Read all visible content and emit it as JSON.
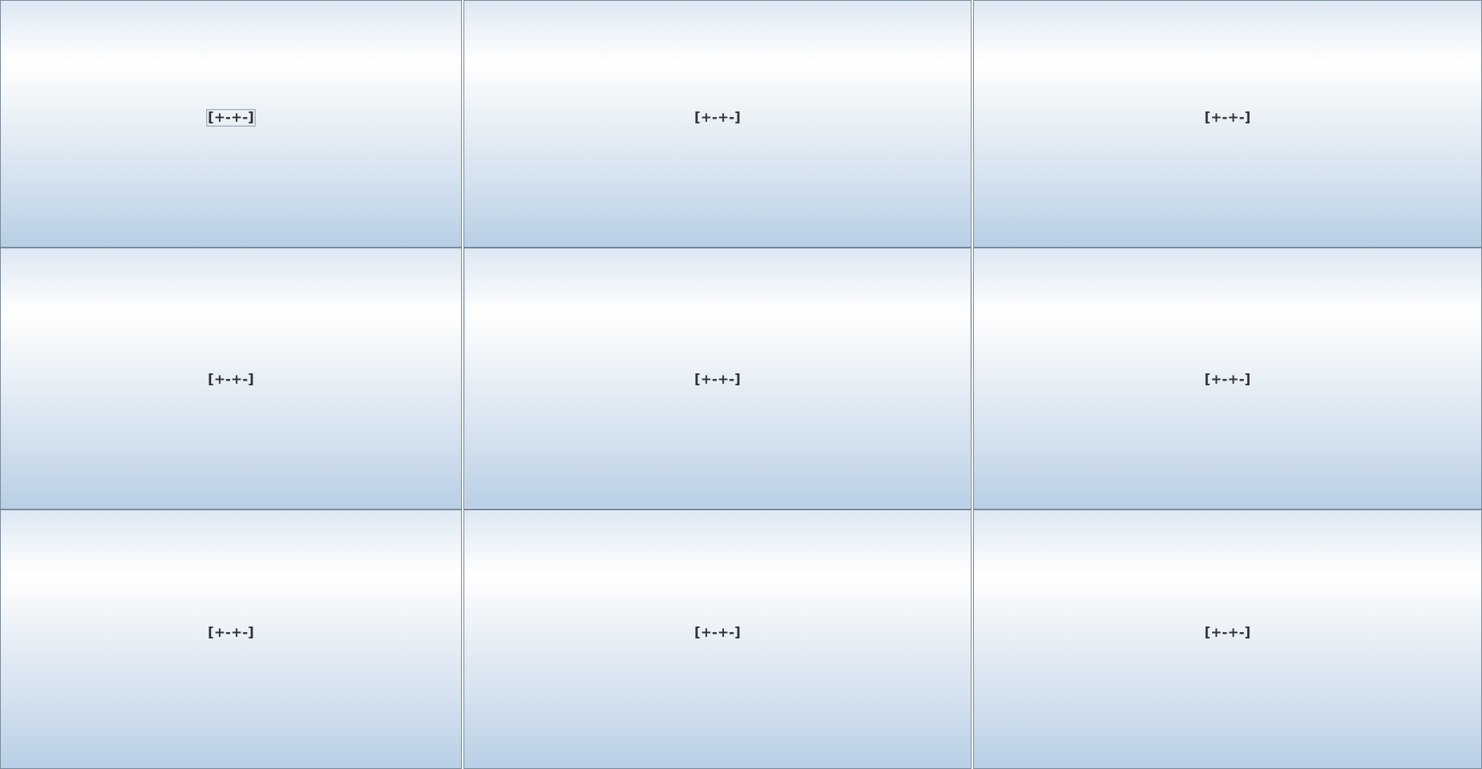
{
  "grid": {
    "buttons": [
      {
        "label": "[+-+-]"
      },
      {
        "label": "[+-+-]"
      },
      {
        "label": "[+-+-]"
      },
      {
        "label": "[+-+-]"
      },
      {
        "label": "[+-+-]"
      },
      {
        "label": "[+-+-]"
      },
      {
        "label": "[+-+-]"
      },
      {
        "label": "[+-+-]"
      },
      {
        "label": "[+-+-]"
      }
    ]
  },
  "theme": {
    "gradient_top": "#dde8f3",
    "gradient_highlight": "#ffffff",
    "gradient_bottom": "#b8cfe5",
    "border": "#7a8a99",
    "text": "#333333"
  }
}
